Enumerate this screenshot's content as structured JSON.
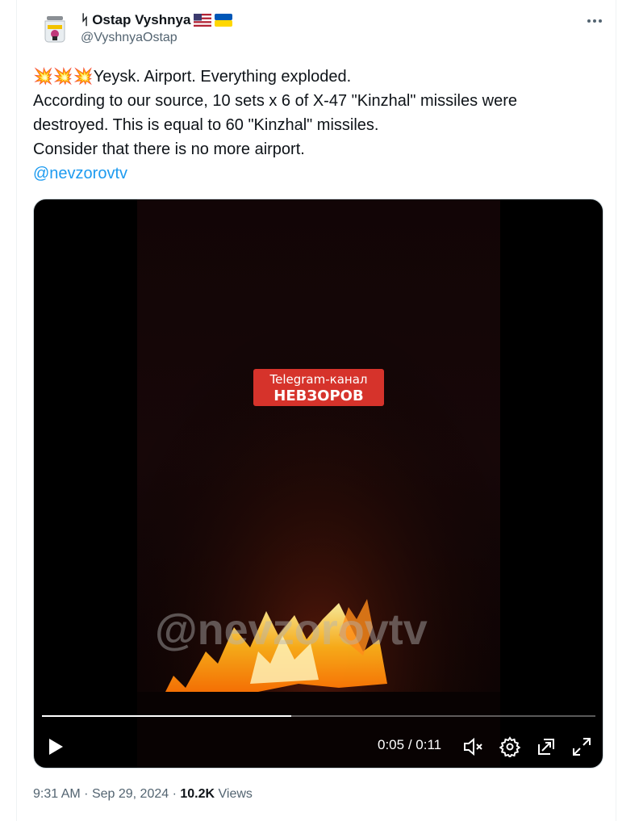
{
  "author": {
    "prefix_glyph": "ᛋ",
    "name": "Ostap Vyshnya",
    "flags": [
      "🇺🇸",
      "🇺🇦"
    ],
    "handle": "@VyshnyaOstap"
  },
  "tweet": {
    "emoji": "💥💥💥",
    "line1": "Yeysk. Airport. Everything exploded.",
    "line2": "According to our source, 10 sets x 6 of X-47 \"Kinzhal\" missiles were destroyed. This is equal to 60 \"Kinzhal\" missiles.",
    "line3": "Consider that there is no more airport.",
    "mention": "@nevzorovtv"
  },
  "video": {
    "badge_line1": "Telegram-канал",
    "badge_line2": "НЕВЗОРОВ",
    "watermark": "@nevzorovtv",
    "current_time": "0:05",
    "duration": "0:11",
    "progress": 0.45
  },
  "meta": {
    "time": "9:31 AM",
    "date": "Sep 29, 2024",
    "views_count": "10.2K",
    "views_label": "Views",
    "separator": "·"
  },
  "colors": {
    "link": "#1d9bf0",
    "secondary_text": "#536471",
    "badge": "#d6332b"
  }
}
